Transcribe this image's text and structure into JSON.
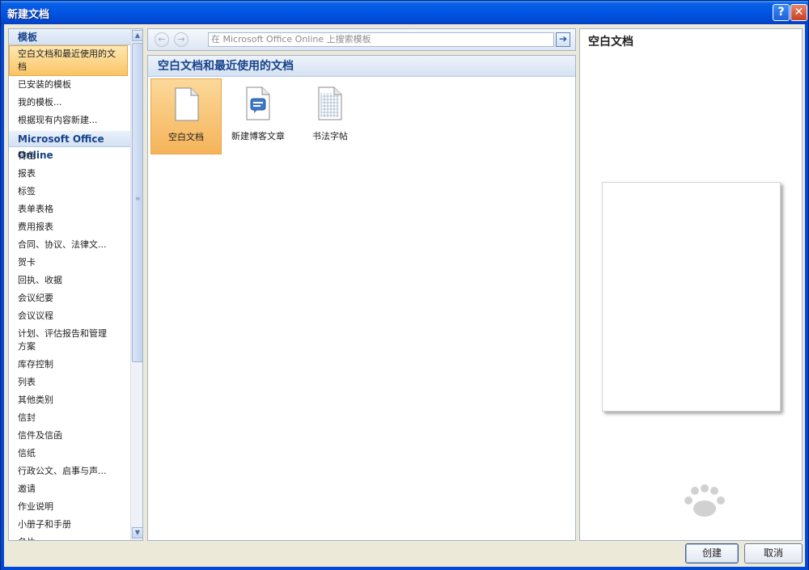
{
  "window": {
    "title": "新建文档",
    "help_glyph": "?",
    "close_glyph": "✕"
  },
  "sidebar": {
    "templates_header": "模板",
    "items": [
      {
        "label": "空白文档和最近使用的文档",
        "selected": true
      },
      {
        "label": "已安装的模板"
      },
      {
        "label": "我的模板..."
      },
      {
        "label": "根据现有内容新建..."
      }
    ],
    "online_header": "Microsoft Office Online",
    "online_items": [
      "特色",
      "报表",
      "标签",
      "表单表格",
      "费用报表",
      "合同、协议、法律文...",
      "贺卡",
      "回执、收据",
      "会议纪要",
      "会议议程",
      "计划、评估报告和管理方案",
      "库存控制",
      "列表",
      "其他类别",
      "信封",
      "信件及信函",
      "信纸",
      "行政公文、启事与声...",
      "邀请",
      "作业说明",
      "小册子和手册",
      "名片"
    ]
  },
  "search": {
    "placeholder": "在 Microsoft Office Online 上搜索模板",
    "back_glyph": "←",
    "forward_glyph": "→",
    "go_glyph": "➔"
  },
  "main": {
    "header": "空白文档和最近使用的文档",
    "tiles": [
      {
        "label": "空白文档",
        "icon": "blank-document-icon",
        "selected": true
      },
      {
        "label": "新建博客文章",
        "icon": "blog-post-icon"
      },
      {
        "label": "书法字帖",
        "icon": "calligraphy-grid-icon"
      }
    ]
  },
  "preview": {
    "title": "空白文档"
  },
  "buttons": {
    "create": "创建",
    "cancel": "取消"
  },
  "colors": {
    "accent_selected": "#fbc466",
    "header_text": "#15428b",
    "titlebar": "#0054e3"
  }
}
